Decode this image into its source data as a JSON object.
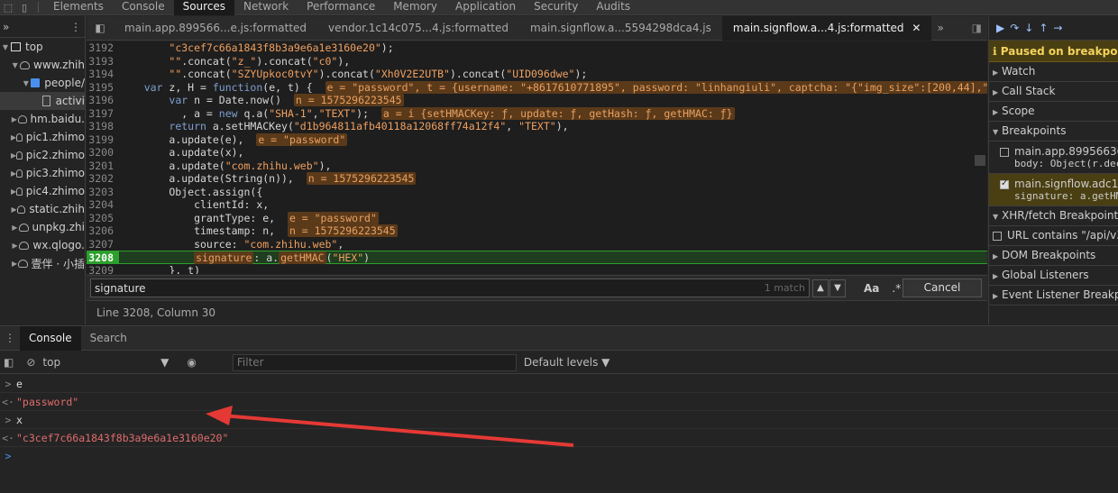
{
  "top_tabs": [
    "Elements",
    "Console",
    "Sources",
    "Network",
    "Performance",
    "Memory",
    "Application",
    "Security",
    "Audits"
  ],
  "nav": {
    "rows": [
      {
        "label": "top",
        "indent": 0,
        "kind": "frame",
        "arrow": "▼"
      },
      {
        "label": "www.zhih",
        "indent": 1,
        "kind": "cloud",
        "arrow": "▼"
      },
      {
        "label": "people/",
        "indent": 2,
        "kind": "folder",
        "arrow": "▼"
      },
      {
        "label": "activi",
        "indent": 3,
        "kind": "file",
        "arrow": ""
      },
      {
        "label": "hm.baidu.",
        "indent": 1,
        "kind": "cloud",
        "arrow": "▶"
      },
      {
        "label": "pic1.zhimo",
        "indent": 1,
        "kind": "cloud",
        "arrow": "▶"
      },
      {
        "label": "pic2.zhimo",
        "indent": 1,
        "kind": "cloud",
        "arrow": "▶"
      },
      {
        "label": "pic3.zhimo",
        "indent": 1,
        "kind": "cloud",
        "arrow": "▶"
      },
      {
        "label": "pic4.zhimo",
        "indent": 1,
        "kind": "cloud",
        "arrow": "▶"
      },
      {
        "label": "static.zhih",
        "indent": 1,
        "kind": "cloud",
        "arrow": "▶"
      },
      {
        "label": "unpkg.zhi",
        "indent": 1,
        "kind": "cloud",
        "arrow": "▶"
      },
      {
        "label": "wx.qlogo.",
        "indent": 1,
        "kind": "cloud",
        "arrow": "▶"
      },
      {
        "label": "壹伴 · 小插",
        "indent": 1,
        "kind": "cloud",
        "arrow": "▶"
      }
    ]
  },
  "editor_tabs": [
    "main.app.899566...e.js:formatted",
    "vendor.1c14c075...4.js:formatted",
    "main.signflow.a...5594298dca4.js",
    "main.signflow.a...4.js:formatted"
  ],
  "code": [
    {
      "n": "3192",
      "html": "        <span class='str'>\"c3cef7c66a1843f8b3a9e6a1e3160e20\"</span>);"
    },
    {
      "n": "3193",
      "html": "        <span class='str'>\"\"</span>.concat(<span class='str'>\"z_\"</span>).concat(<span class='str'>\"c0\"</span>),"
    },
    {
      "n": "3194",
      "html": "        <span class='str'>\"\"</span>.concat(<span class='str'>\"SZYUpkoc0tvY\"</span>).concat(<span class='str'>\"Xh0V2E2UTB\"</span>).concat(<span class='str'>\"UID096dwe\"</span>);"
    },
    {
      "n": "3195",
      "html": "    <span class='kw'>var</span> z, H = <span class='kw'>function</span>(e, t) {  <span class='val'>e = \"password\", t = {username: \"+8617610771895\", password: \"linhangiuli\", captcha: \"{\"img_size\":[200,44],\"im</span>"
    },
    {
      "n": "3196",
      "html": "        <span class='kw'>var</span> n = Date.now()  <span class='val'>n = 1575296223545</span>"
    },
    {
      "n": "3197",
      "html": "          , a = <span class='kw'>new</span> q.a(<span class='str'>\"SHA-1\"</span>,<span class='str'>\"TEXT\"</span>);  <span class='val'>a = i {setHMACKey: ƒ, update: ƒ, getHash: ƒ, getHMAC: ƒ}</span>"
    },
    {
      "n": "3198",
      "html": "        <span class='kw'>return</span> a.setHMACKey(<span class='str'>\"d1b964811afb40118a12068ff74a12f4\"</span>, <span class='str'>\"TEXT\"</span>),"
    },
    {
      "n": "3199",
      "html": "        a.update(e),  <span class='val'>e = \"password\"</span>"
    },
    {
      "n": "3200",
      "html": "        a.update(x),"
    },
    {
      "n": "3201",
      "html": "        a.update(<span class='str'>\"com.zhihu.web\"</span>),"
    },
    {
      "n": "3202",
      "html": "        a.update(String(n)),  <span class='val'>n = 1575296223545</span>"
    },
    {
      "n": "3203",
      "html": "        Object.assign({"
    },
    {
      "n": "3204",
      "html": "            clientId: x,"
    },
    {
      "n": "3205",
      "html": "            grantType: e,  <span class='val'>e = \"password\"</span>"
    },
    {
      "n": "3206",
      "html": "            timestamp: n,  <span class='val'>n = 1575296223545</span>"
    },
    {
      "n": "3207",
      "html": "            source: <span class='str'>\"com.zhihu.web\"</span>,"
    },
    {
      "n": "3208",
      "html": "            <span class='val'>signature</span>: a.<span class='val'>getHMAC</span>(<span class='str'>\"HEX\"</span>)",
      "current": true
    },
    {
      "n": "3209",
      "html": "        }, t)"
    }
  ],
  "search": {
    "query": "signature",
    "count": "1 match",
    "case_label": "Aa",
    "regex_label": ".*",
    "cancel": "Cancel"
  },
  "status": "Line 3208, Column 30",
  "debugger": {
    "paused": "Paused on breakpoint",
    "sections": [
      "Watch",
      "Call Stack",
      "Scope",
      "Breakpoints"
    ],
    "breakpoints": [
      {
        "file": "main.app.8995663608",
        "code": "body: Object(r.dec",
        "checked": false
      },
      {
        "file": "main.signflow.adc1979",
        "code": "signature: a.getHM",
        "checked": true
      }
    ],
    "xhr_title": "XHR/fetch Breakpoints",
    "xhr_item": "URL contains \"/api/v3/c",
    "more_sections": [
      "DOM Breakpoints",
      "Global Listeners",
      "Event Listener Breakpoin"
    ]
  },
  "drawer": {
    "tabs": [
      "Console",
      "Search"
    ]
  },
  "console_toolbar": {
    "context": "top",
    "filter_placeholder": "Filter",
    "levels": "Default levels"
  },
  "console_rows": [
    {
      "prefix": ">",
      "text": "e",
      "type": "input"
    },
    {
      "prefix": "<·",
      "text": "\"password\"",
      "type": "output"
    },
    {
      "prefix": ">",
      "text": "x",
      "type": "input"
    },
    {
      "prefix": "<·",
      "text": "\"c3cef7c66a1843f8b3a9e6a1e3160e20\"",
      "type": "output"
    },
    {
      "prefix": ">",
      "text": "",
      "type": "prompt"
    }
  ],
  "colors": {
    "annotation_arrow": "#e53935",
    "current_line": "#2ca02c",
    "paused_bg": "#4a3f12"
  }
}
